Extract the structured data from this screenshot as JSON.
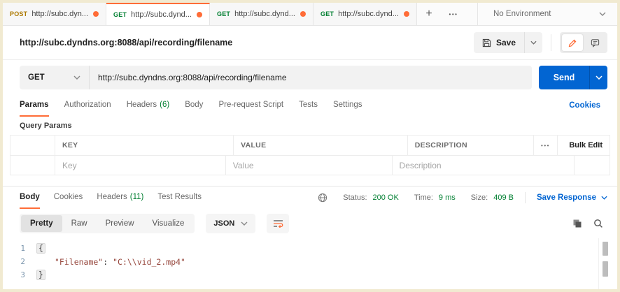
{
  "colors": {
    "accent_orange": "#ff6c37",
    "primary_blue": "#0265d2",
    "success_green": "#007f31",
    "method_get": "#007f31",
    "method_post": "#ad7a03",
    "code_string": "#96463c",
    "screen_border_cream": "#f1ead1"
  },
  "icons": {
    "ellipsis": "•••",
    "plus": "+"
  },
  "tabbar": {
    "tabs": [
      {
        "method": "POST",
        "url": "http://subc.dyn..."
      },
      {
        "method": "GET",
        "url": "http://subc.dynd..."
      },
      {
        "method": "GET",
        "url": "http://subc.dynd..."
      },
      {
        "method": "GET",
        "url": "http://subc.dynd..."
      }
    ],
    "environment": "No Environment"
  },
  "request": {
    "title": "http://subc.dyndns.org:8088/api/recording/filename",
    "save_label": "Save",
    "method": "GET",
    "url": "http://subc.dyndns.org:8088/api/recording/filename",
    "send_label": "Send",
    "tabs": [
      {
        "label": "Params"
      },
      {
        "label": "Authorization"
      },
      {
        "label": "Headers",
        "count": "(6)"
      },
      {
        "label": "Body"
      },
      {
        "label": "Pre-request Script"
      },
      {
        "label": "Tests"
      },
      {
        "label": "Settings"
      }
    ],
    "cookies_link": "Cookies",
    "query_params": {
      "heading": "Query Params",
      "columns": [
        "KEY",
        "VALUE",
        "DESCRIPTION"
      ],
      "bulk_edit_label": "Bulk Edit",
      "placeholders": {
        "key": "Key",
        "value": "Value",
        "description": "Description"
      }
    }
  },
  "response": {
    "tabs": [
      {
        "label": "Body"
      },
      {
        "label": "Cookies"
      },
      {
        "label": "Headers",
        "count": "(11)"
      },
      {
        "label": "Test Results"
      }
    ],
    "status": {
      "status_label": "Status:",
      "status_value": "200 OK",
      "time_label": "Time:",
      "time_value": "9 ms",
      "size_label": "Size:",
      "size_value": "409 B"
    },
    "save_response_label": "Save Response",
    "view_tabs": [
      "Pretty",
      "Raw",
      "Preview",
      "Visualize"
    ],
    "format": "JSON",
    "body": {
      "line_numbers": [
        "1",
        "2",
        "3"
      ],
      "line1": "{",
      "line2_key": "\"Filename\"",
      "line2_sep": ": ",
      "line2_value": "\"C:\\\\vid_2.mp4\"",
      "line3": "}"
    }
  }
}
